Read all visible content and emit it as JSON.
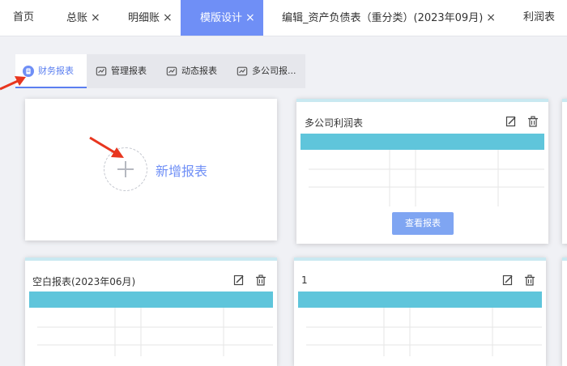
{
  "top_tabs": [
    {
      "label": "首页",
      "closable": false
    },
    {
      "label": "总账",
      "closable": true
    },
    {
      "label": "明细账",
      "closable": true
    },
    {
      "label": "模版设计",
      "closable": true,
      "active": true
    },
    {
      "label": "编辑_资产负债表（重分类）(2023年09月)",
      "closable": true
    },
    {
      "label": "利润表",
      "closable": false
    }
  ],
  "close_glyph": "×",
  "sub_tabs": [
    {
      "label": "财务报表",
      "icon": "finance-report-icon",
      "active": true
    },
    {
      "label": "管理报表",
      "icon": "report-icon"
    },
    {
      "label": "动态报表",
      "icon": "report-icon"
    },
    {
      "label": "多公司报...",
      "icon": "report-icon"
    }
  ],
  "add_card": {
    "label": "新增报表",
    "icon": "plus-icon"
  },
  "cards": [
    {
      "title": "多公司利润表",
      "button": "查看报表",
      "actions": [
        "edit-icon",
        "trash-icon"
      ]
    },
    {
      "title": "空白报表(2023年06月)",
      "actions": [
        "edit-icon",
        "trash-icon"
      ]
    },
    {
      "title": "1",
      "actions": [
        "edit-icon",
        "trash-icon"
      ]
    }
  ],
  "colors": {
    "accent": "#6f8ff6",
    "sheet_header": "#5fc5db",
    "view_button": "#7fa5f2",
    "annotation_arrow": "#e8361f"
  }
}
